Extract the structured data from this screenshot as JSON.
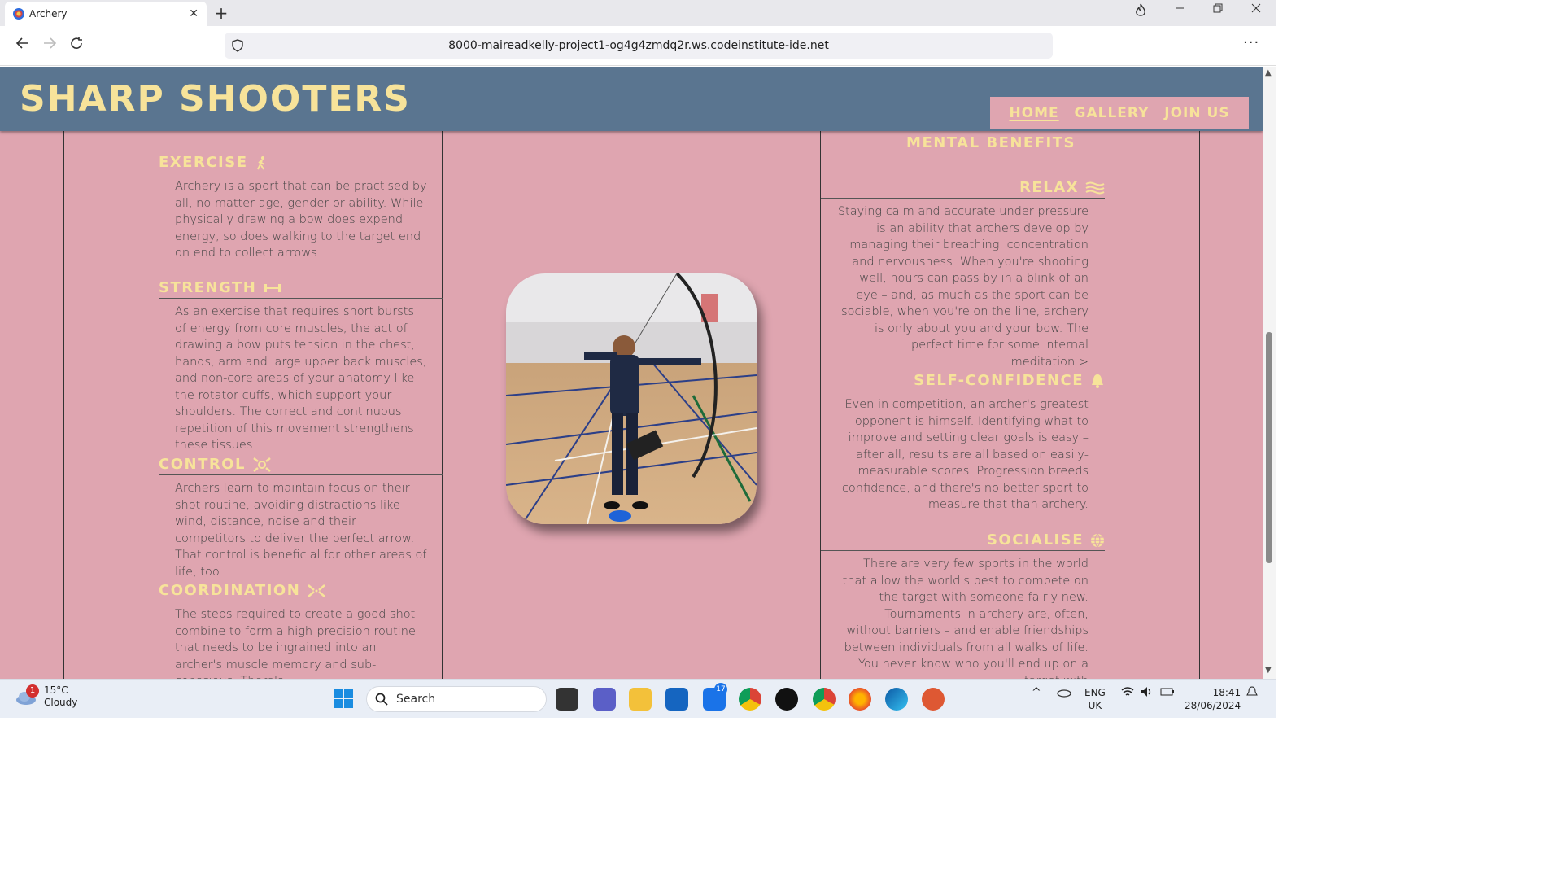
{
  "browser": {
    "tab_title": "Archery",
    "tab_close": "✕",
    "new_tab": "+",
    "url": "8000-maireadkelly-project1-og4g4zmdq2r.ws.codeinstitute-ide.net",
    "menu": "···"
  },
  "site": {
    "logo": "SHARP SHOOTERS",
    "nav": [
      {
        "label": "HOME",
        "active": true
      },
      {
        "label": "GALLERY",
        "active": false
      },
      {
        "label": "JOIN US",
        "active": false
      }
    ]
  },
  "left": {
    "sections": [
      {
        "title": "EXERCISE",
        "icon": "walking-person-icon",
        "text": "Archery is a sport that can be practised by all, no matter age, gender or ability. While physically drawing a bow does expend energy, so does walking to the target end on end to collect arrows."
      },
      {
        "title": "STRENGTH",
        "icon": "dumbbell-icon",
        "text": "As an exercise that requires short bursts of energy from core muscles, the act of drawing a bow puts tension in the chest, hands, arm and large upper back muscles, and non-core areas of your anatomy like the rotator cuffs, which support your shoulders. The correct and continuous repetition of this movement strengthens these tissues."
      },
      {
        "title": "CONTROL",
        "icon": "crosshair-icon",
        "text": "Archers learn to maintain focus on their shot routine, avoiding distractions like wind, distance, noise and their competitors to deliver the perfect arrow. That control is beneficial for other areas of life, too"
      },
      {
        "title": "COORDINATION",
        "icon": "arrows-converge-icon",
        "text": "The steps required to create a good shot combine to form a high-precision routine that needs to be ingrained into an archer's muscle memory and sub-conscious. There's"
      }
    ]
  },
  "right": {
    "title": "MENTAL BENEFITS",
    "sections": [
      {
        "title": "RELAX",
        "icon": "water-waves-icon",
        "text": "Staying calm and accurate under pressure is an ability that archers develop by managing their breathing, concentration and nervousness. When you're shooting well, hours can pass by in a blink of an eye – and, as much as the sport can be sociable, when you're on the line, archery is only about you and your bow. The perfect time for some internal meditation.>"
      },
      {
        "title": "SELF-CONFIDENCE",
        "icon": "bell-icon",
        "text": "Even in competition, an archer's greatest opponent is himself. Identifying what to improve and setting clear goals is easy – after all, results are all based on easily-measurable scores. Progression breeds confidence, and there's no better sport to measure that than archery."
      },
      {
        "title": "SOCIALISE",
        "icon": "globe-icon",
        "text": "There are very few sports in the world that allow the world's best to compete on the target with someone fairly new. Tournaments in archery are, often, without barriers – and enable friendships between individuals from all walks of life. You never know who you'll end up on a target with"
      }
    ]
  },
  "taskbar": {
    "weather_temp": "15°C",
    "weather_desc": "Cloudy",
    "weather_badge": "1",
    "search": "Search",
    "outlook_badge": "17",
    "lang": "ENG",
    "region": "UK",
    "time": "18:41",
    "date": "28/06/2024"
  },
  "colors": {
    "header_bg": "#5a7590",
    "page_bg": "#dfa5b0",
    "accent_yellow": "#f7e39a"
  }
}
